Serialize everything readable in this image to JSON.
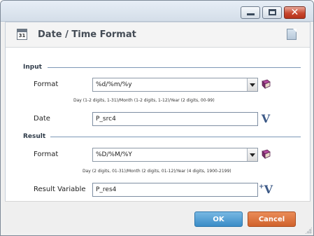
{
  "dialog": {
    "title": "Date / Time Format",
    "ok_label": "OK",
    "cancel_label": "Cancel"
  },
  "input": {
    "section_label": "Input",
    "format_label": "Format",
    "format_value": "%d/%m/%y",
    "format_hint": "Day (1-2 digits, 1-31)/Month (1-2 digits, 1-12)/Year (2 digits, 00-99)",
    "date_label": "Date",
    "date_value": "P_src4"
  },
  "result": {
    "section_label": "Result",
    "format_label": "Format",
    "format_value": "%D/%M/%Y",
    "format_hint": "Day (2 digits, 01-31)/Month (2 digits, 01-12)/Year (4 digits, 1900-2199)",
    "variable_label": "Result Variable",
    "variable_value": "P_res4"
  },
  "icons": {
    "header_icon": "calendar-icon",
    "header_right_icon": "notes-icon",
    "format_picker_icon": "book-icon",
    "variable_icon": "variable-v-icon",
    "add_variable_icon": "add-variable-icon",
    "calendar_number": "31"
  },
  "colors": {
    "ok_button": "#3a8cc7",
    "cancel_button": "#d0622b",
    "section_line": "#7d98b6",
    "variable_icon": "#3d5a87"
  }
}
